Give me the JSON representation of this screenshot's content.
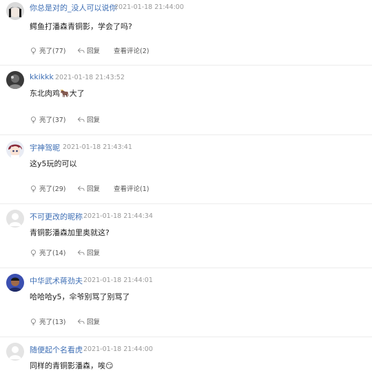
{
  "comments": [
    {
      "user": "你总是对的_没人可以说你",
      "time": "2021-01-18 21:44:00",
      "text": "鳄鱼打潘森青铜影，学会了吗?",
      "like_label": "亮了(77)",
      "reply_label": "回复",
      "view_replies_label": "查看评论(2)",
      "avatar": "dark-hair-portrait"
    },
    {
      "user": "kkikkk",
      "time": "2021-01-18 21:43:52",
      "text": "东北肉鸡🐂大了",
      "like_label": "亮了(37)",
      "reply_label": "回复",
      "avatar": "dark-photo"
    },
    {
      "user": "宇神驾昵",
      "time": "2021-01-18 21:43:41",
      "text": "这y5玩的可以",
      "like_label": "亮了(29)",
      "reply_label": "回复",
      "view_replies_label": "查看评论(1)",
      "avatar": "anime-character"
    },
    {
      "user": "不可更改的昵称",
      "time": "2021-01-18 21:44:34",
      "text": "青铜影潘森加里奥就这?",
      "like_label": "亮了(14)",
      "reply_label": "回复",
      "avatar": "default-gray"
    },
    {
      "user": "中华武术蒋劲夫",
      "time": "2021-01-18 21:44:01",
      "text": "哈哈哈y5，伞爷别骂了别骂了",
      "like_label": "亮了(13)",
      "reply_label": "回复",
      "avatar": "blue-portrait"
    },
    {
      "user": "随便起个名看虎",
      "time": "2021-01-18 21:44:00",
      "text": "同样的青铜影潘森，唉😏",
      "avatar": "default-gray"
    }
  ],
  "colors": {
    "username": "#3f6fb5",
    "meta": "#999999",
    "divider": "#ececec"
  }
}
